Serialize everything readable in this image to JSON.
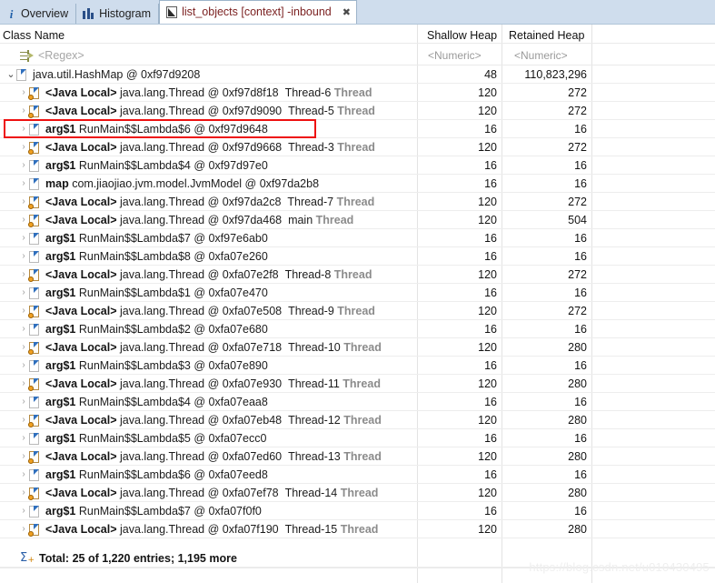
{
  "tabs": [
    {
      "label": "Overview",
      "icon": "info-icon",
      "active": false,
      "closable": false
    },
    {
      "label": "Histogram",
      "icon": "histogram-icon",
      "active": false,
      "closable": false
    },
    {
      "label": "list_objects [context] -inbound",
      "icon": "list-objects-icon",
      "active": true,
      "closable": true,
      "close_glyph": "✖"
    }
  ],
  "table": {
    "columns": [
      {
        "header": "Class Name",
        "filter": "<Regex>",
        "align": "left"
      },
      {
        "header": "Shallow Heap",
        "filter": "<Numeric>",
        "align": "right"
      },
      {
        "header": "Retained Heap",
        "filter": "<Numeric>",
        "align": "right"
      },
      {
        "header": "",
        "filter": "",
        "align": "right"
      }
    ],
    "rows": [
      {
        "indent": 0,
        "twisty": "open",
        "icon": "object-icon",
        "prefix": "",
        "name": "java.util.HashMap @ 0xf97d9208",
        "suffix": "",
        "shallow": "48",
        "retained": "110,823,296"
      },
      {
        "indent": 1,
        "twisty": "closed",
        "icon": "java-local-object-icon",
        "prefix": "<Java Local>",
        "name": "java.lang.Thread @ 0xf97d8f18",
        "suffix": "Thread-6 Thread",
        "shallow": "120",
        "retained": "272"
      },
      {
        "indent": 1,
        "twisty": "closed",
        "icon": "java-local-object-icon",
        "prefix": "<Java Local>",
        "name": "java.lang.Thread @ 0xf97d9090",
        "suffix": "Thread-5 Thread",
        "shallow": "120",
        "retained": "272"
      },
      {
        "indent": 1,
        "twisty": "closed",
        "icon": "object-icon",
        "prefix": "arg$1",
        "name": "RunMain$$Lambda$6 @ 0xf97d9648",
        "suffix": "",
        "shallow": "16",
        "retained": "16",
        "highlighted": true
      },
      {
        "indent": 1,
        "twisty": "closed",
        "icon": "java-local-object-icon",
        "prefix": "<Java Local>",
        "name": "java.lang.Thread @ 0xf97d9668",
        "suffix": "Thread-3 Thread",
        "shallow": "120",
        "retained": "272"
      },
      {
        "indent": 1,
        "twisty": "closed",
        "icon": "object-icon",
        "prefix": "arg$1",
        "name": "RunMain$$Lambda$4 @ 0xf97d97e0",
        "suffix": "",
        "shallow": "16",
        "retained": "16"
      },
      {
        "indent": 1,
        "twisty": "closed",
        "icon": "object-icon",
        "prefix": "map",
        "name": "com.jiaojiao.jvm.model.JvmModel @ 0xf97da2b8",
        "suffix": "",
        "shallow": "16",
        "retained": "16"
      },
      {
        "indent": 1,
        "twisty": "closed",
        "icon": "java-local-object-icon",
        "prefix": "<Java Local>",
        "name": "java.lang.Thread @ 0xf97da2c8",
        "suffix": "Thread-7 Thread",
        "shallow": "120",
        "retained": "272"
      },
      {
        "indent": 1,
        "twisty": "closed",
        "icon": "java-local-object-icon",
        "prefix": "<Java Local>",
        "name": "java.lang.Thread @ 0xf97da468",
        "suffix": "main Thread",
        "shallow": "120",
        "retained": "504"
      },
      {
        "indent": 1,
        "twisty": "closed",
        "icon": "object-icon",
        "prefix": "arg$1",
        "name": "RunMain$$Lambda$7 @ 0xf97e6ab0",
        "suffix": "",
        "shallow": "16",
        "retained": "16"
      },
      {
        "indent": 1,
        "twisty": "closed",
        "icon": "object-icon",
        "prefix": "arg$1",
        "name": "RunMain$$Lambda$8 @ 0xfa07e260",
        "suffix": "",
        "shallow": "16",
        "retained": "16"
      },
      {
        "indent": 1,
        "twisty": "closed",
        "icon": "java-local-object-icon",
        "prefix": "<Java Local>",
        "name": "java.lang.Thread @ 0xfa07e2f8",
        "suffix": "Thread-8 Thread",
        "shallow": "120",
        "retained": "272"
      },
      {
        "indent": 1,
        "twisty": "closed",
        "icon": "object-icon",
        "prefix": "arg$1",
        "name": "RunMain$$Lambda$1 @ 0xfa07e470",
        "suffix": "",
        "shallow": "16",
        "retained": "16"
      },
      {
        "indent": 1,
        "twisty": "closed",
        "icon": "java-local-object-icon",
        "prefix": "<Java Local>",
        "name": "java.lang.Thread @ 0xfa07e508",
        "suffix": "Thread-9 Thread",
        "shallow": "120",
        "retained": "272"
      },
      {
        "indent": 1,
        "twisty": "closed",
        "icon": "object-icon",
        "prefix": "arg$1",
        "name": "RunMain$$Lambda$2 @ 0xfa07e680",
        "suffix": "",
        "shallow": "16",
        "retained": "16"
      },
      {
        "indent": 1,
        "twisty": "closed",
        "icon": "java-local-object-icon",
        "prefix": "<Java Local>",
        "name": "java.lang.Thread @ 0xfa07e718",
        "suffix": "Thread-10 Thread",
        "shallow": "120",
        "retained": "280"
      },
      {
        "indent": 1,
        "twisty": "closed",
        "icon": "object-icon",
        "prefix": "arg$1",
        "name": "RunMain$$Lambda$3 @ 0xfa07e890",
        "suffix": "",
        "shallow": "16",
        "retained": "16"
      },
      {
        "indent": 1,
        "twisty": "closed",
        "icon": "java-local-object-icon",
        "prefix": "<Java Local>",
        "name": "java.lang.Thread @ 0xfa07e930",
        "suffix": "Thread-11 Thread",
        "shallow": "120",
        "retained": "280"
      },
      {
        "indent": 1,
        "twisty": "closed",
        "icon": "object-icon",
        "prefix": "arg$1",
        "name": "RunMain$$Lambda$4 @ 0xfa07eaa8",
        "suffix": "",
        "shallow": "16",
        "retained": "16"
      },
      {
        "indent": 1,
        "twisty": "closed",
        "icon": "java-local-object-icon",
        "prefix": "<Java Local>",
        "name": "java.lang.Thread @ 0xfa07eb48",
        "suffix": "Thread-12 Thread",
        "shallow": "120",
        "retained": "280"
      },
      {
        "indent": 1,
        "twisty": "closed",
        "icon": "object-icon",
        "prefix": "arg$1",
        "name": "RunMain$$Lambda$5 @ 0xfa07ecc0",
        "suffix": "",
        "shallow": "16",
        "retained": "16"
      },
      {
        "indent": 1,
        "twisty": "closed",
        "icon": "java-local-object-icon",
        "prefix": "<Java Local>",
        "name": "java.lang.Thread @ 0xfa07ed60",
        "suffix": "Thread-13 Thread",
        "shallow": "120",
        "retained": "280"
      },
      {
        "indent": 1,
        "twisty": "closed",
        "icon": "object-icon",
        "prefix": "arg$1",
        "name": "RunMain$$Lambda$6 @ 0xfa07eed8",
        "suffix": "",
        "shallow": "16",
        "retained": "16"
      },
      {
        "indent": 1,
        "twisty": "closed",
        "icon": "java-local-object-icon",
        "prefix": "<Java Local>",
        "name": "java.lang.Thread @ 0xfa07ef78",
        "suffix": "Thread-14 Thread",
        "shallow": "120",
        "retained": "280"
      },
      {
        "indent": 1,
        "twisty": "closed",
        "icon": "object-icon",
        "prefix": "arg$1",
        "name": "RunMain$$Lambda$7 @ 0xfa07f0f0",
        "suffix": "",
        "shallow": "16",
        "retained": "16"
      },
      {
        "indent": 1,
        "twisty": "closed",
        "icon": "java-local-object-icon",
        "prefix": "<Java Local>",
        "name": "java.lang.Thread @ 0xfa07f190",
        "suffix": "Thread-15 Thread",
        "shallow": "120",
        "retained": "280"
      }
    ],
    "total_row": {
      "icon": "sum-icon",
      "text": "Total: 25 of 1,220 entries; 1,195 more",
      "shallow": "",
      "retained": ""
    }
  },
  "annotation": {
    "type": "red-rectangle",
    "color": "#ee1111"
  },
  "watermark": {
    "text": "https://blog.csdn.net/u010430495"
  },
  "colors": {
    "tab_bar_bg": "#cfdded",
    "active_tab_text": "#7a1f1f",
    "grid_line": "#eaeaea",
    "filter_text": "#a6a6a6",
    "thread_label": "#8b8b8b",
    "highlight": "#ee1111"
  }
}
